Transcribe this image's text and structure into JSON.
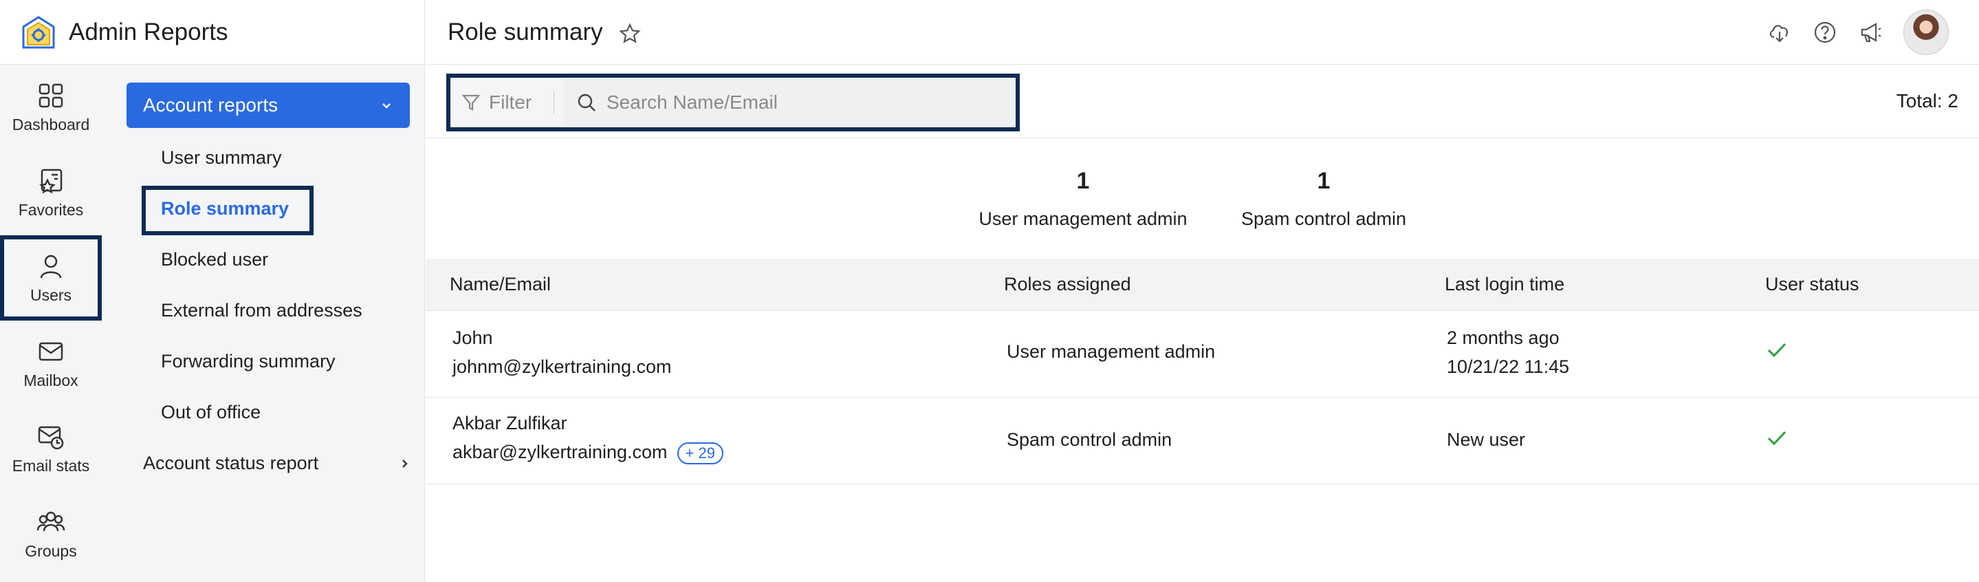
{
  "app": {
    "title": "Admin Reports",
    "accent": "#2a6ae0",
    "highlight_border": "#0e2b54"
  },
  "rail": {
    "items": [
      {
        "label": "Dashboard",
        "icon": "grid-icon"
      },
      {
        "label": "Favorites",
        "icon": "favorites-icon"
      },
      {
        "label": "Users",
        "icon": "user-icon",
        "active": true
      },
      {
        "label": "Mailbox",
        "icon": "mailbox-icon"
      },
      {
        "label": "Email stats",
        "icon": "email-stats-icon"
      },
      {
        "label": "Groups",
        "icon": "groups-icon"
      }
    ]
  },
  "subnav": {
    "section_label": "Account reports",
    "items": [
      {
        "label": "User summary"
      },
      {
        "label": "Role summary",
        "active": true
      },
      {
        "label": "Blocked user"
      },
      {
        "label": "External from addresses"
      },
      {
        "label": "Forwarding summary"
      },
      {
        "label": "Out of office"
      }
    ],
    "status_report_label": "Account status report"
  },
  "header": {
    "page_title": "Role summary",
    "icons": [
      "download-cloud-icon",
      "help-icon",
      "announcement-icon",
      "avatar"
    ]
  },
  "toolbar": {
    "filter_label": "Filter",
    "search_placeholder": "Search Name/Email",
    "total_label": "Total: 2"
  },
  "stats": [
    {
      "count": "1",
      "role": "User management admin"
    },
    {
      "count": "1",
      "role": "Spam control admin"
    }
  ],
  "table": {
    "columns": [
      "Name/Email",
      "Roles assigned",
      "Last login time",
      "User status"
    ],
    "rows": [
      {
        "name": "John",
        "email": "johnm@zylkertraining.com",
        "badge": "",
        "role": "User management admin",
        "login_primary": "2 months ago",
        "login_secondary": "10/21/22 11:45",
        "status_icon": "check-icon"
      },
      {
        "name": "Akbar Zulfikar",
        "email": "akbar@zylkertraining.com",
        "badge": "+ 29",
        "role": "Spam control admin",
        "login_primary": "New user",
        "login_secondary": "",
        "status_icon": "check-icon"
      }
    ]
  }
}
